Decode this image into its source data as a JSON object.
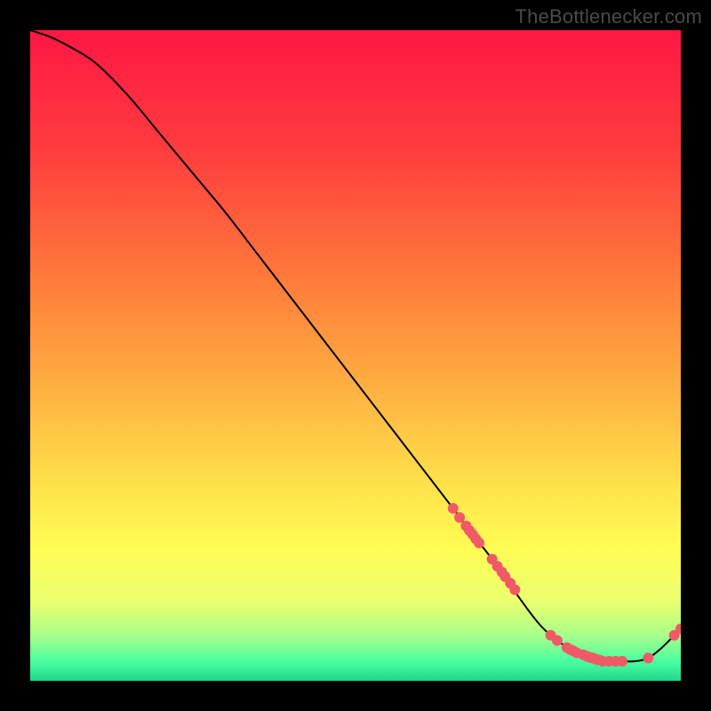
{
  "watermark": "TheBottlenecker.com",
  "gradient": {
    "stops": [
      {
        "offset": "0%",
        "color": "#ff1744"
      },
      {
        "offset": "18%",
        "color": "#ff3b3e"
      },
      {
        "offset": "38%",
        "color": "#ff7a3a"
      },
      {
        "offset": "55%",
        "color": "#ffb042"
      },
      {
        "offset": "70%",
        "color": "#ffe24a"
      },
      {
        "offset": "80%",
        "color": "#fffd55"
      },
      {
        "offset": "88%",
        "color": "#eaff70"
      },
      {
        "offset": "93%",
        "color": "#a8ff8a"
      },
      {
        "offset": "97%",
        "color": "#4bffa0"
      },
      {
        "offset": "100%",
        "color": "#1fd78e"
      }
    ]
  },
  "chart_data": {
    "type": "line",
    "title": "",
    "xlabel": "",
    "ylabel": "",
    "xlim": [
      0,
      100
    ],
    "ylim": [
      0,
      100
    ],
    "legend": false,
    "grid": false,
    "series": [
      {
        "name": "bottleneck-curve",
        "x": [
          0,
          3,
          6,
          10,
          15,
          20,
          25,
          30,
          35,
          40,
          45,
          50,
          55,
          60,
          65,
          68,
          70,
          73,
          75,
          78,
          80,
          82,
          85,
          88,
          90,
          93,
          95,
          97,
          100
        ],
        "y": [
          100,
          99,
          97.5,
          95,
          90,
          84,
          78,
          72,
          65.5,
          59,
          52.5,
          46,
          39.5,
          33,
          26.5,
          22.5,
          20,
          16,
          13,
          9,
          7,
          5.5,
          4,
          3,
          3,
          3,
          3.5,
          5,
          8
        ]
      }
    ],
    "markers": [
      {
        "name": "bottleneck-points",
        "color": "#ef5a66",
        "points": [
          {
            "x": 65,
            "y": 26.5
          },
          {
            "x": 66,
            "y": 25.1
          },
          {
            "x": 67,
            "y": 23.8
          },
          {
            "x": 67.5,
            "y": 23.1
          },
          {
            "x": 68,
            "y": 22.5
          },
          {
            "x": 68.5,
            "y": 21.8
          },
          {
            "x": 69,
            "y": 21.2
          },
          {
            "x": 71,
            "y": 18.7
          },
          {
            "x": 71.8,
            "y": 17.6
          },
          {
            "x": 72.5,
            "y": 16.7
          },
          {
            "x": 73,
            "y": 16.0
          },
          {
            "x": 73.8,
            "y": 15.0
          },
          {
            "x": 74.5,
            "y": 14.0
          },
          {
            "x": 80,
            "y": 7.0
          },
          {
            "x": 81,
            "y": 6.2
          },
          {
            "x": 82.5,
            "y": 5.1
          },
          {
            "x": 83,
            "y": 4.8
          },
          {
            "x": 83.5,
            "y": 4.6
          },
          {
            "x": 84,
            "y": 4.3
          },
          {
            "x": 85,
            "y": 4.0
          },
          {
            "x": 85.5,
            "y": 3.8
          },
          {
            "x": 86,
            "y": 3.6
          },
          {
            "x": 86.5,
            "y": 3.5
          },
          {
            "x": 87,
            "y": 3.3
          },
          {
            "x": 87.5,
            "y": 3.2
          },
          {
            "x": 88,
            "y": 3.0
          },
          {
            "x": 89,
            "y": 3.0
          },
          {
            "x": 90,
            "y": 3.0
          },
          {
            "x": 91,
            "y": 3.0
          },
          {
            "x": 95,
            "y": 3.5
          },
          {
            "x": 99,
            "y": 7.0
          },
          {
            "x": 100,
            "y": 8.0
          }
        ]
      }
    ]
  }
}
